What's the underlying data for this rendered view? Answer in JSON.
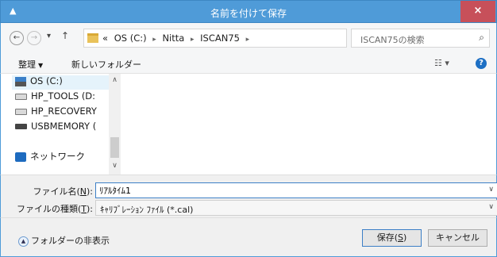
{
  "window": {
    "title": "名前を付けて保存",
    "app_glyph": "▲",
    "close_label": "×"
  },
  "address": {
    "back": "←",
    "forward": "→",
    "recent_caret": "▾",
    "up": "↑",
    "overflow": "«",
    "crumbs": [
      "OS (C:)",
      "Nitta",
      "ISCAN75"
    ],
    "separator": "▸",
    "drop": "∨",
    "refresh": "↻"
  },
  "search": {
    "placeholder": "ISCAN75の検索",
    "icon": "⌕"
  },
  "toolbar": {
    "organize_label": "整理",
    "organize_caret": "▼",
    "new_folder_label": "新しいフォルダー",
    "view_icon": "☷ ▾",
    "help_icon": "?"
  },
  "tree": {
    "items": [
      {
        "label": "OS (C:)",
        "icon": "os-drive-icon"
      },
      {
        "label": "HP_TOOLS (D:",
        "icon": "drive-icon"
      },
      {
        "label": "HP_RECOVERY",
        "icon": "drive-icon"
      },
      {
        "label": "USBMEMORY (",
        "icon": "usb-drive-icon"
      },
      {
        "label": "ネットワーク",
        "icon": "network-icon"
      }
    ],
    "scroll_up": "∧",
    "scroll_down": "∨"
  },
  "form": {
    "filename_label": "ファイル名(",
    "filename_key": "N",
    "filename_suffix": "):",
    "filename_value": "ﾘｱﾙﾀｲﾑ1",
    "filetype_label": "ファイルの種類(",
    "filetype_key": "T",
    "filetype_suffix": "):",
    "filetype_value": "ｷｬﾘﾌﾞﾚｰｼｮﾝ ﾌｧｲﾙ (*.cal)",
    "caret": "∨"
  },
  "footer": {
    "hide_folders_label": "フォルダーの非表示",
    "hide_folders_glyph": "▲",
    "save_label_prefix": "保存(",
    "save_key": "S",
    "save_label_suffix": ")",
    "cancel_label": "キャンセル"
  }
}
